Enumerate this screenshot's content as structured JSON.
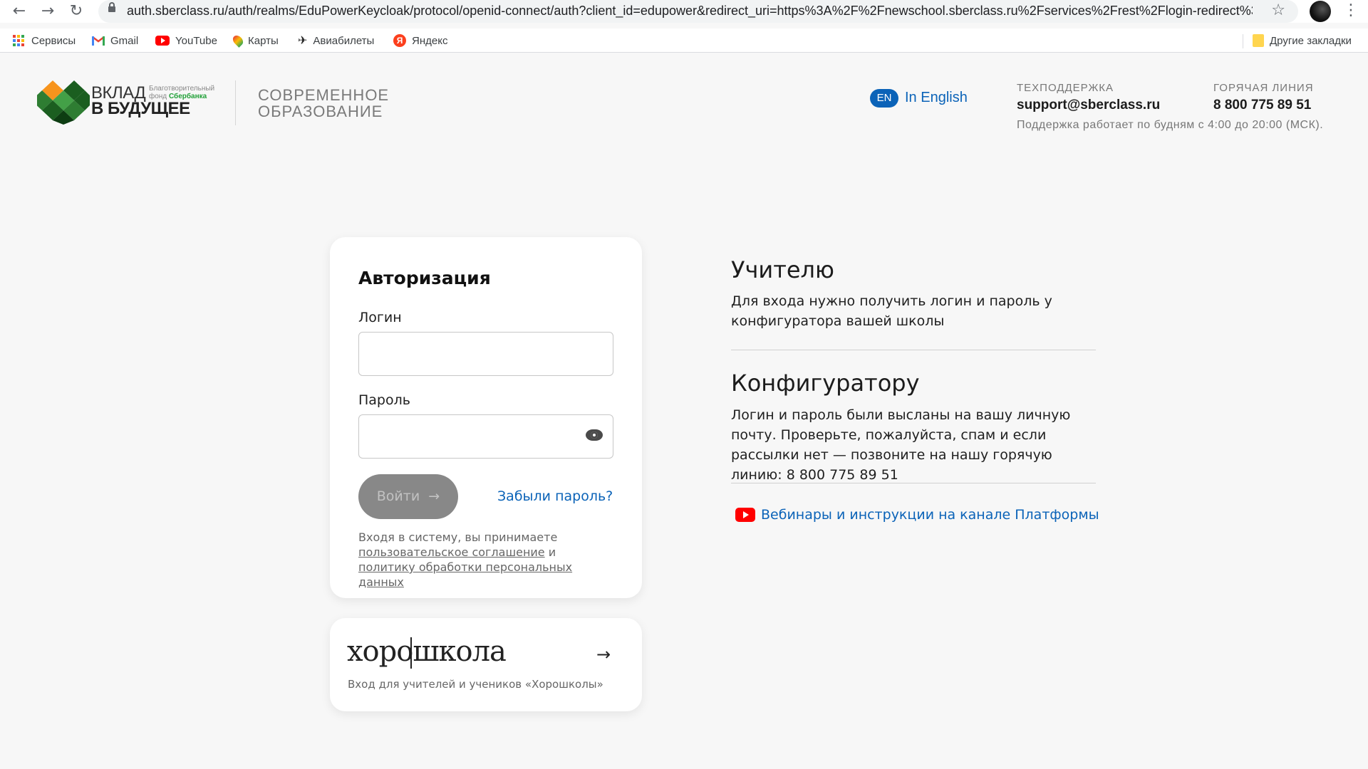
{
  "browser": {
    "url": "auth.sberclass.ru/auth/realms/EduPowerKeycloak/protocol/openid-connect/auth?client_id=edupower&redirect_uri=https%3A%2F%2Fnewschool.sberclass.ru%2Fservices%2Frest%2Flogin-redirect%3Freturn...",
    "bookmarks": [
      "Сервисы",
      "Gmail",
      "YouTube",
      "Карты",
      "Авиабилеты",
      "Яндекс"
    ],
    "other_bookmarks": "Другие закладки"
  },
  "header": {
    "logo_line1": "ВКЛАД",
    "logo_line2": "В БУДУЩЕЕ",
    "logo_small1": "Благотворительный",
    "logo_small2_prefix": "фонд",
    "logo_small2_brand": "Сбербанка",
    "brand_line1": "СОВРЕМЕННОЕ",
    "brand_line2": "ОБРАЗОВАНИЕ",
    "lang_badge": "EN",
    "lang_link": "In English",
    "support_label": "ТЕХПОДДЕРЖКА",
    "support_email": "support@sberclass.ru",
    "hotline_label": "ГОРЯЧАЯ ЛИНИЯ",
    "hotline_phone": "8 800 775 89 51",
    "support_hours": "Поддержка работает по будням с 4:00 до 20:00 (МСК)."
  },
  "login": {
    "title": "Авторизация",
    "login_label": "Логин",
    "login_value": "",
    "password_label": "Пароль",
    "password_value": "",
    "submit": "Войти",
    "forgot": "Забыли пароль?",
    "terms_prefix": "Входя в систему, вы принимаете",
    "terms_link1": "пользовательское соглашение",
    "terms_and": "и",
    "terms_link2": "политику обработки персональных данных"
  },
  "horoshkola": {
    "logo": "хорошкола",
    "subtitle": "Вход для учителей и учеников «Хорошколы»"
  },
  "info": {
    "teacher_title": "Учителю",
    "teacher_text": "Для входа нужно получить логин и пароль у конфигуратора вашей школы",
    "config_title": "Конфигуратору",
    "config_text": "Логин и пароль были высланы на вашу личную почту. Проверьте, пожалуйста, спам и если рассылки нет — позвоните на нашу горячую линию: 8 800 775 89 51",
    "youtube_link": "Вебинары и инструкции на канале Платформы"
  },
  "colors": {
    "accent": "#0b63b8",
    "button_disabled": "#888888",
    "background": "#f7f7f7",
    "brand_green": "#21a038"
  }
}
